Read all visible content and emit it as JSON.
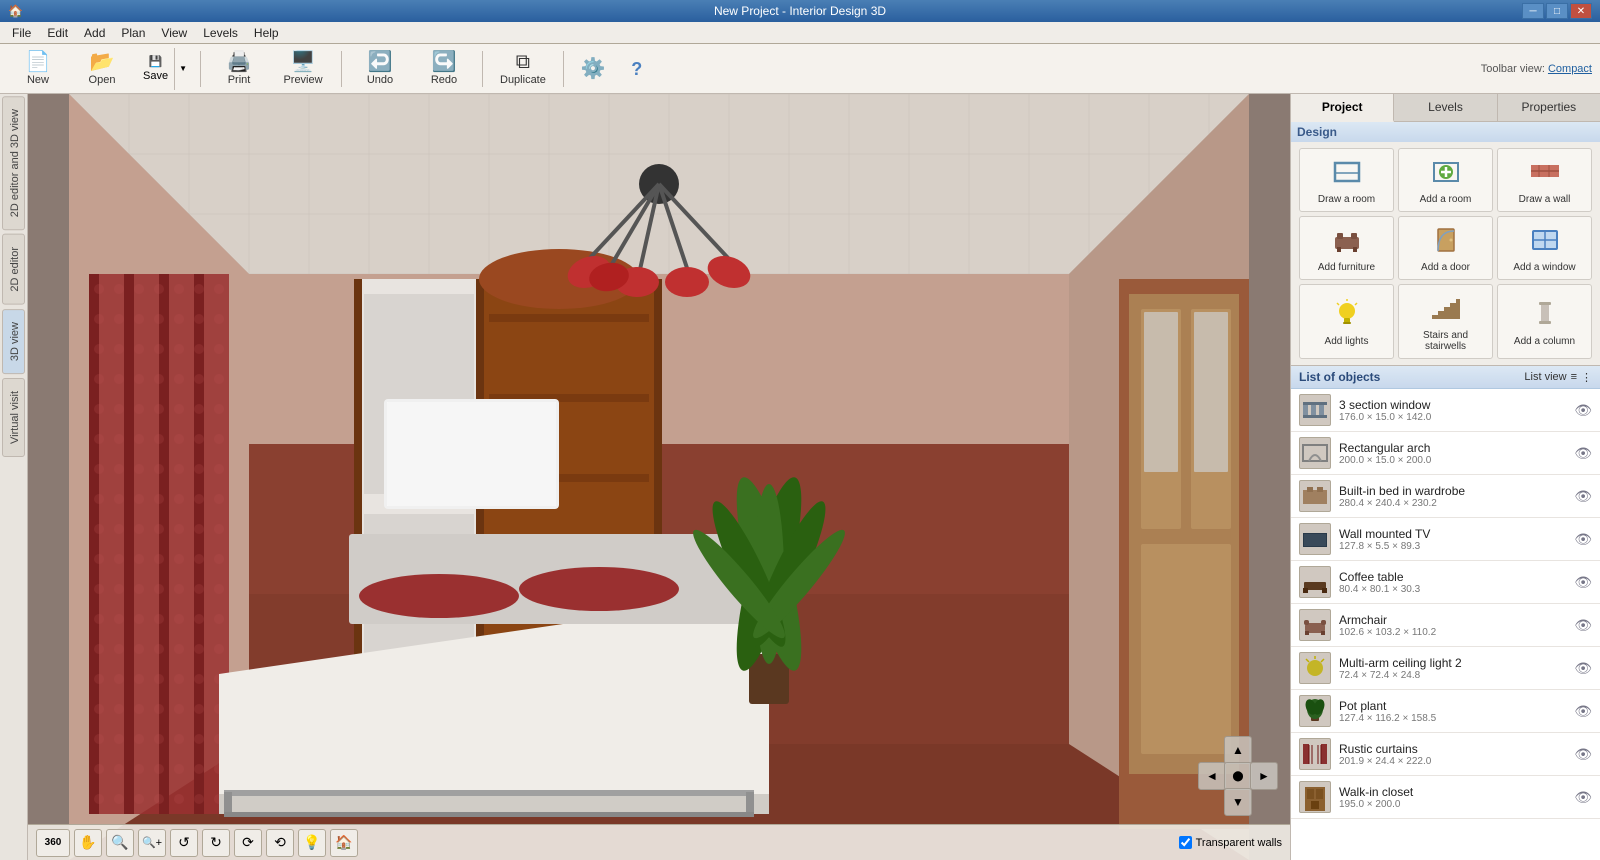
{
  "titlebar": {
    "title": "New Project - Interior Design 3D",
    "icon": "🏠",
    "controls": [
      "─",
      "□",
      "✕"
    ]
  },
  "menubar": {
    "items": [
      "File",
      "Edit",
      "Add",
      "Plan",
      "View",
      "Levels",
      "Help"
    ]
  },
  "toolbar": {
    "buttons": [
      {
        "label": "New",
        "icon": "📄"
      },
      {
        "label": "Open",
        "icon": "📂"
      },
      {
        "label": "Save",
        "icon": "💾"
      },
      {
        "label": "Print",
        "icon": "🖨"
      },
      {
        "label": "Preview",
        "icon": "🖥"
      },
      {
        "label": "Undo",
        "icon": "↩"
      },
      {
        "label": "Redo",
        "icon": "↪"
      },
      {
        "label": "Duplicate",
        "icon": "⧉"
      }
    ],
    "settings_icon": "⚙",
    "help_icon": "?",
    "toolbar_view_label": "Toolbar view:",
    "toolbar_view_link": "Compact"
  },
  "side_tabs": [
    {
      "label": "2D editor and 3D view",
      "active": false
    },
    {
      "label": "2D editor",
      "active": false
    },
    {
      "label": "3D view",
      "active": true
    },
    {
      "label": "Virtual visit",
      "active": false
    }
  ],
  "viewport": {
    "transparent_walls_label": "Transparent walls"
  },
  "right_panel": {
    "tabs": [
      {
        "label": "Project",
        "active": true
      },
      {
        "label": "Levels",
        "active": false
      },
      {
        "label": "Properties",
        "active": false
      }
    ],
    "design_section": {
      "title": "Design",
      "buttons": [
        {
          "label": "Draw a room",
          "icon": "🏠"
        },
        {
          "label": "Add a room",
          "icon": "➕"
        },
        {
          "label": "Draw a wall",
          "icon": "🧱"
        },
        {
          "label": "Add furniture",
          "icon": "🪑"
        },
        {
          "label": "Add a door",
          "icon": "🚪"
        },
        {
          "label": "Add a window",
          "icon": "🪟"
        },
        {
          "label": "Add lights",
          "icon": "💡"
        },
        {
          "label": "Stairs and stairwells",
          "icon": "🪜"
        },
        {
          "label": "Add a column",
          "icon": "🏛"
        }
      ]
    },
    "list_of_objects": {
      "title": "List of objects",
      "view_label": "List view",
      "items": [
        {
          "name": "3 section window",
          "dims": "176.0 × 15.0 × 142.0",
          "icon": "🪟"
        },
        {
          "name": "Rectangular arch",
          "dims": "200.0 × 15.0 × 200.0",
          "icon": "⬜"
        },
        {
          "name": "Built-in bed in wardrobe",
          "dims": "280.4 × 240.4 × 230.2",
          "icon": "🛏"
        },
        {
          "name": "Wall mounted TV",
          "dims": "127.8 × 5.5 × 89.3",
          "icon": "📺"
        },
        {
          "name": "Coffee table",
          "dims": "80.4 × 80.1 × 30.3",
          "icon": "🪑"
        },
        {
          "name": "Armchair",
          "dims": "102.6 × 103.2 × 110.2",
          "icon": "🛋"
        },
        {
          "name": "Multi-arm ceiling light 2",
          "dims": "72.4 × 72.4 × 24.8",
          "icon": "💡"
        },
        {
          "name": "Pot plant",
          "dims": "127.4 × 116.2 × 158.5",
          "icon": "🌿"
        },
        {
          "name": "Rustic curtains",
          "dims": "201.9 × 24.4 × 222.0",
          "icon": "🪟"
        },
        {
          "name": "Walk-in closet",
          "dims": "195.0 × 200.0",
          "icon": "🚪"
        }
      ]
    }
  },
  "viewport_bottom_tools": [
    {
      "icon": "360",
      "label": "360 view"
    },
    {
      "icon": "✋",
      "label": "pan"
    },
    {
      "icon": "🔍-",
      "label": "zoom out"
    },
    {
      "icon": "🔍+",
      "label": "zoom in"
    },
    {
      "icon": "↺",
      "label": "rotate left"
    },
    {
      "icon": "↻",
      "label": "rotate right"
    },
    {
      "icon": "↩",
      "label": "tilt back"
    },
    {
      "icon": "↪",
      "label": "tilt forward"
    },
    {
      "icon": "💡",
      "label": "light"
    },
    {
      "icon": "🏠",
      "label": "home"
    }
  ]
}
